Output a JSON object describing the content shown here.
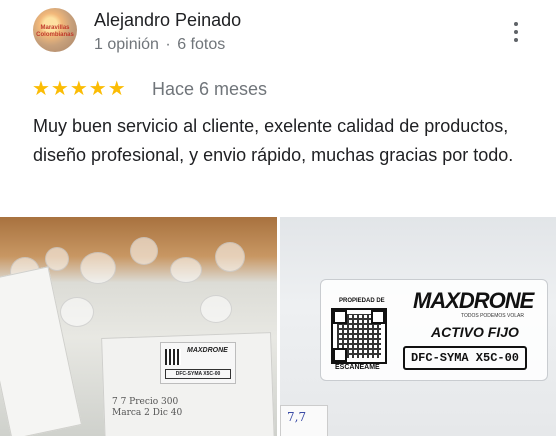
{
  "review": {
    "author": {
      "name": "Alejandro Peinado",
      "reviews_count": "1 opinión",
      "separator": "·",
      "photos_count": "6 fotos",
      "avatar_text": "Maravillas Colombianas"
    },
    "rating": {
      "value": 5,
      "max": 5,
      "stars": "★★★★★"
    },
    "relative_time": "Hace 6 meses",
    "text": "Muy buen servicio al cliente, exelente calidad de productos, diseño profesional, y envio rápido, muchas gracias por todo.",
    "more_icon": "more-vert-icon"
  },
  "photos": [
    {
      "brand": "MAXDRONE",
      "code": "DFC-SYMA X5C-00",
      "handwriting": "7 7 Precio 300 Marca 2 Dic 40"
    },
    {
      "property_label": "PROPIEDAD DE",
      "brand": "MAXDRONE",
      "tagline": "TODOS PODEMOS VOLAR",
      "asset_label": "ACTIVO FIJO",
      "code": "DFC-SYMA X5C-00",
      "scan_label": "ESCANEAME",
      "handwriting": "7,7"
    }
  ],
  "colors": {
    "star": "#fbbc04",
    "text": "#202124",
    "secondary": "#70757a"
  }
}
